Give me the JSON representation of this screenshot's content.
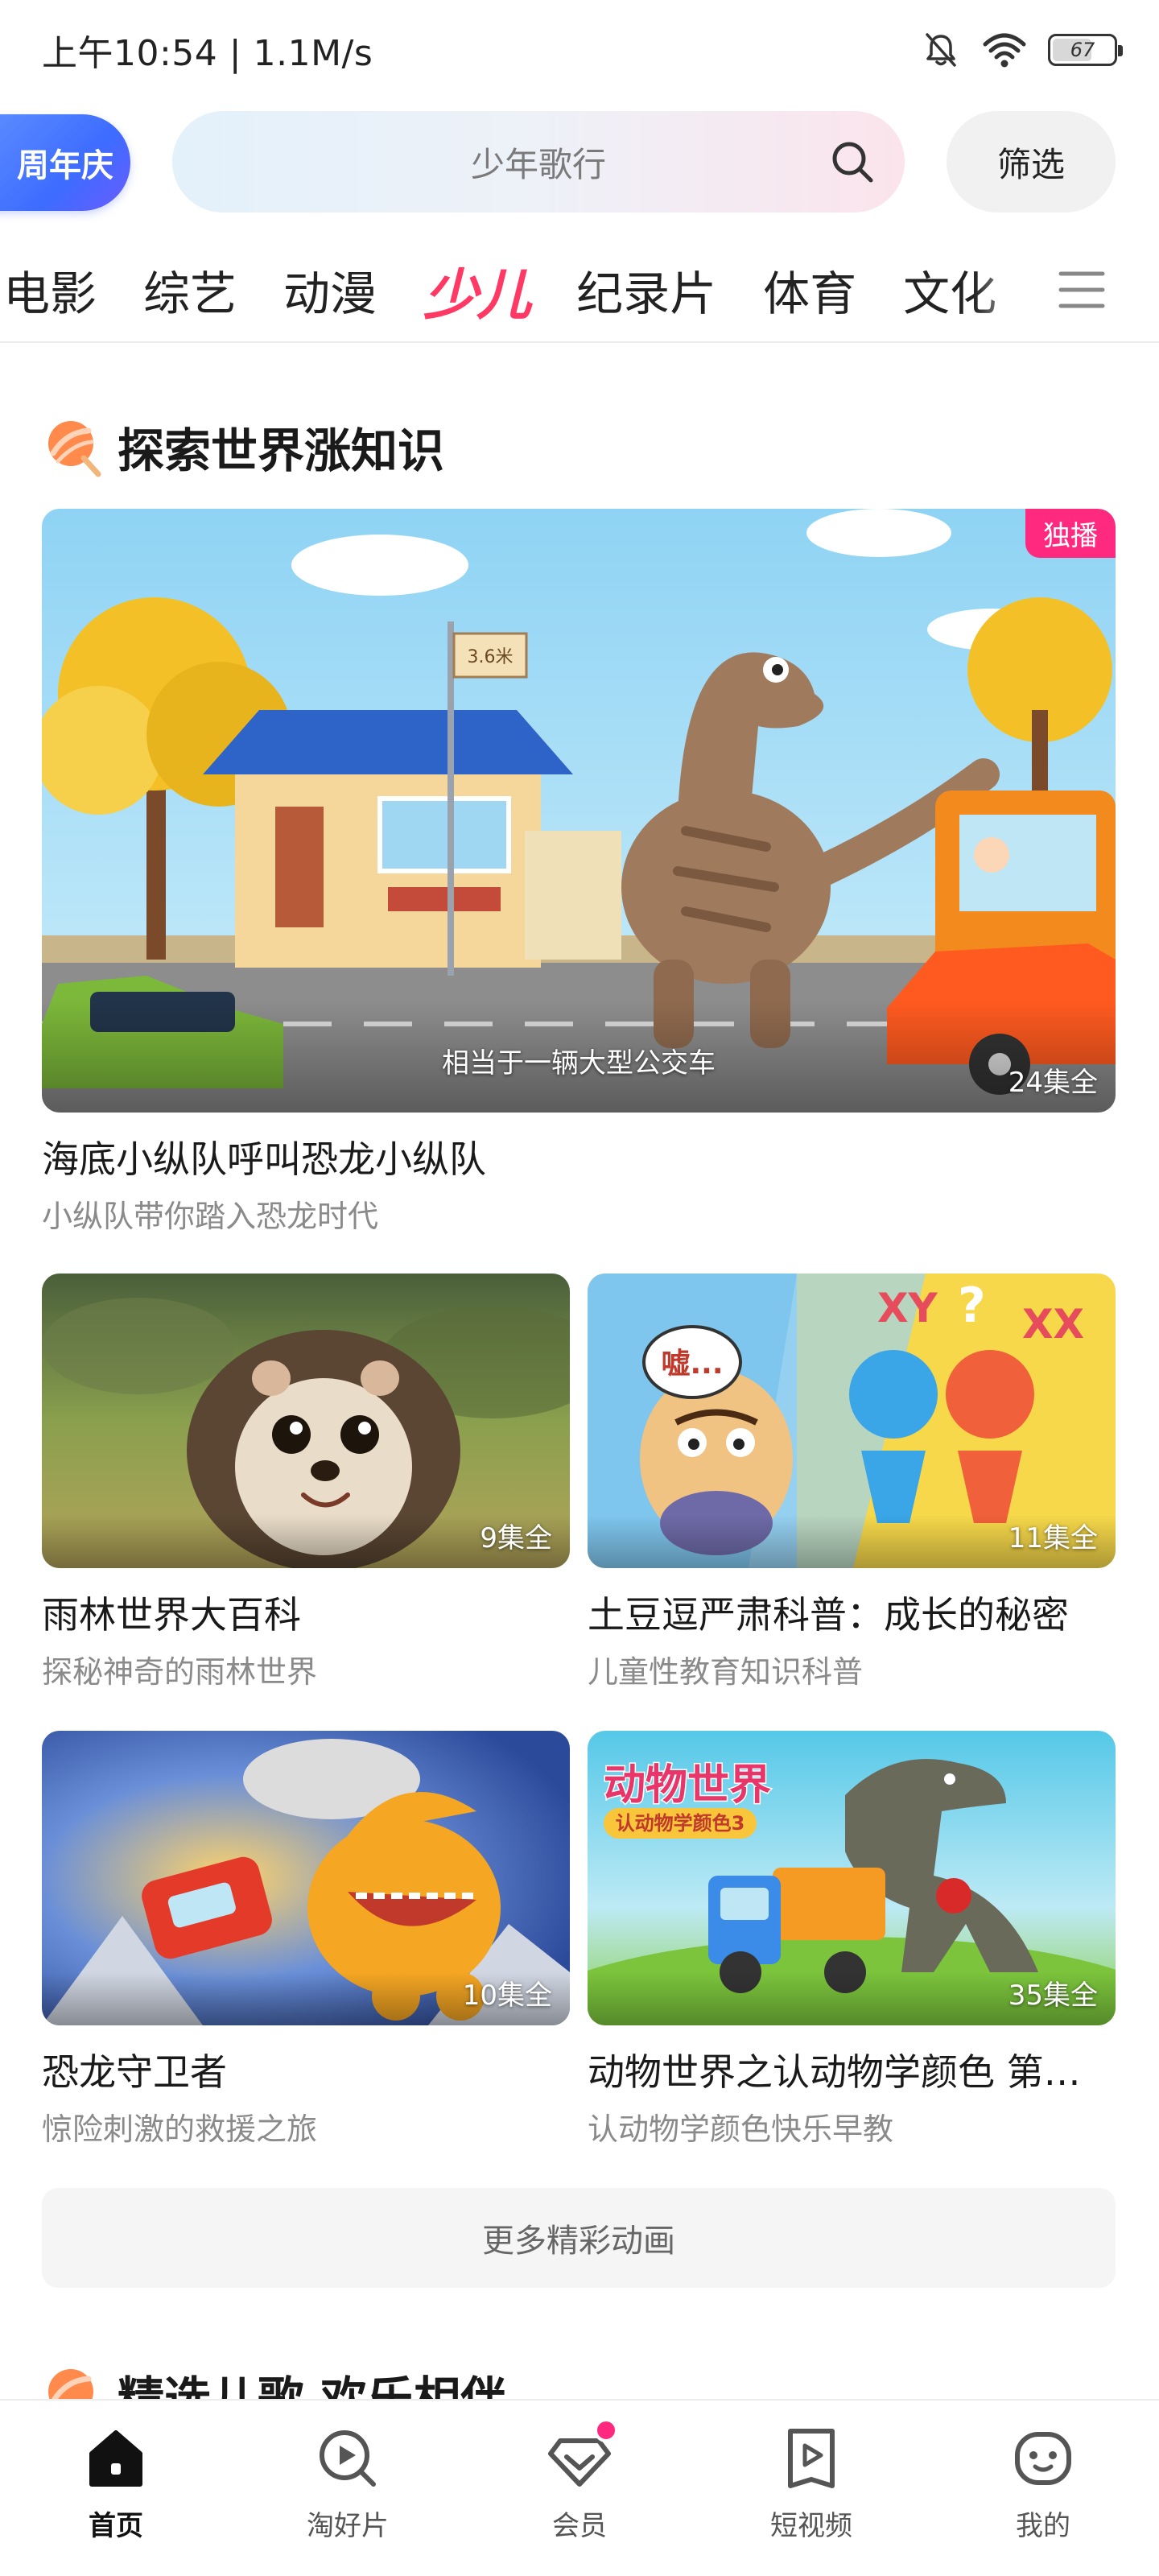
{
  "status_bar": {
    "time": "上午10:54 | 1.1M/s",
    "battery": "67",
    "battery_level": 0.67
  },
  "search": {
    "anniversary_label": "周年庆",
    "placeholder": "少年歌行",
    "filter_label": "筛选"
  },
  "categories": {
    "items": [
      "电影",
      "综艺",
      "动漫",
      "少儿",
      "纪录片",
      "体育",
      "文化"
    ],
    "active": "少儿"
  },
  "section": {
    "title": "探索世界涨知识",
    "featured": {
      "title": "海底小纵队呼叫恐龙小纵队",
      "subtitle": "小纵队带你踏入恐龙时代",
      "episodes": "24集全",
      "badge": "独播",
      "caption": "相当于一辆大型公交车",
      "sign_text": "3.6米"
    },
    "cards": [
      {
        "title": "雨林世界大百科",
        "subtitle": "探秘神奇的雨林世界",
        "episodes": "9集全"
      },
      {
        "title": "土豆逗严肃科普：成长的秘密",
        "subtitle": "儿童性教育知识科普",
        "episodes": "11集全",
        "bubble_text": "嘘..."
      },
      {
        "title": "恐龙守卫者",
        "subtitle": "惊险刺激的救援之旅",
        "episodes": "10集全"
      },
      {
        "title": "动物世界之认动物学颜色 第…",
        "subtitle": "认动物学颜色快乐早教",
        "episodes": "35集全",
        "poster_title": "动物世界",
        "poster_subtitle": "认动物学颜色3"
      }
    ],
    "more_label": "更多精彩动画"
  },
  "section2": {
    "title": "精选儿歌 欢乐相伴"
  },
  "bottom_nav": {
    "items": [
      {
        "label": "首页",
        "icon": "home-icon"
      },
      {
        "label": "淘好片",
        "icon": "discover-icon"
      },
      {
        "label": "会员",
        "icon": "vip-diamond-icon"
      },
      {
        "label": "短视频",
        "icon": "short-video-icon"
      },
      {
        "label": "我的",
        "icon": "profile-icon"
      }
    ],
    "active": "首页"
  },
  "colors": {
    "accent": "#ff3864",
    "badge": "#ff2a7f",
    "anniversary": "#3d6cff"
  }
}
